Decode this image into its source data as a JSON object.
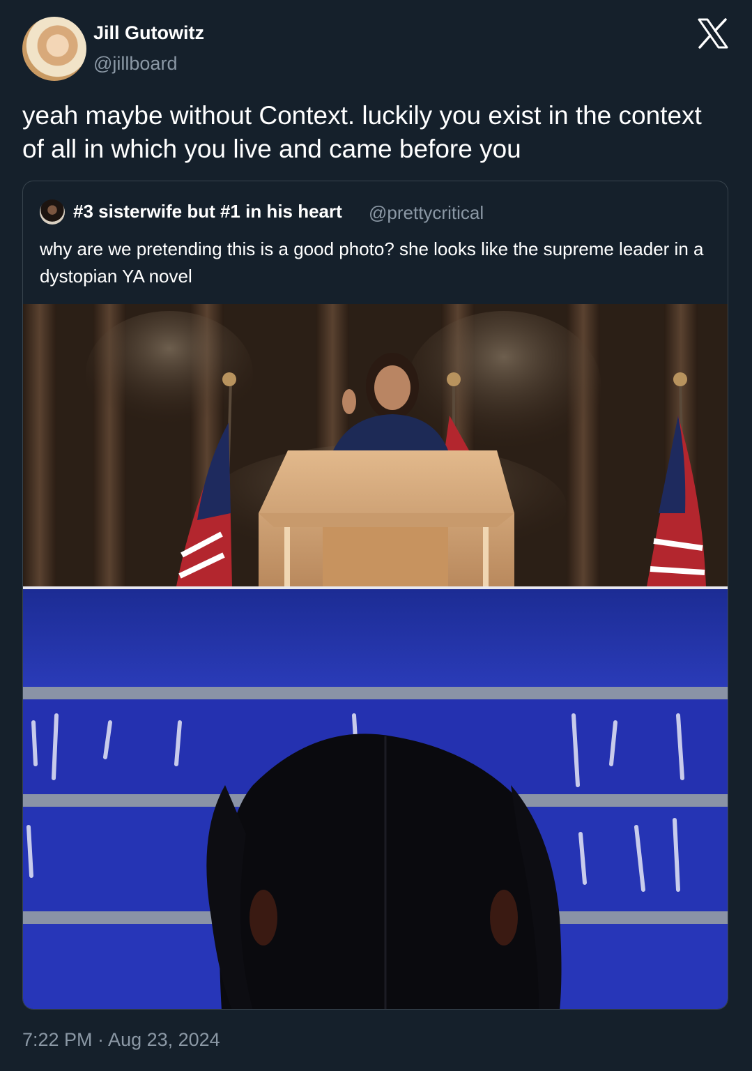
{
  "tweet": {
    "author_name": "Jill Gutowitz",
    "author_handle": "@jillboard",
    "text": "yeah maybe without Context. luckily you exist in the context of all in which you live and came before you",
    "timestamp": "7:22 PM · Aug 23, 2024"
  },
  "quoted_tweet": {
    "author_name": "#3 sisterwife but #1 in his heart",
    "author_handle": "@prettycritical",
    "text": "why are we pretending this is a good photo? she looks like the supreme leader in a dystopian YA novel"
  },
  "icons": {
    "platform_logo": "x-logo-icon"
  },
  "colors": {
    "background": "#15202b",
    "primary_text": "#ffffff",
    "secondary_text": "#8b98a5",
    "border": "#38444d",
    "stage_blue": "#1f2f9e"
  }
}
